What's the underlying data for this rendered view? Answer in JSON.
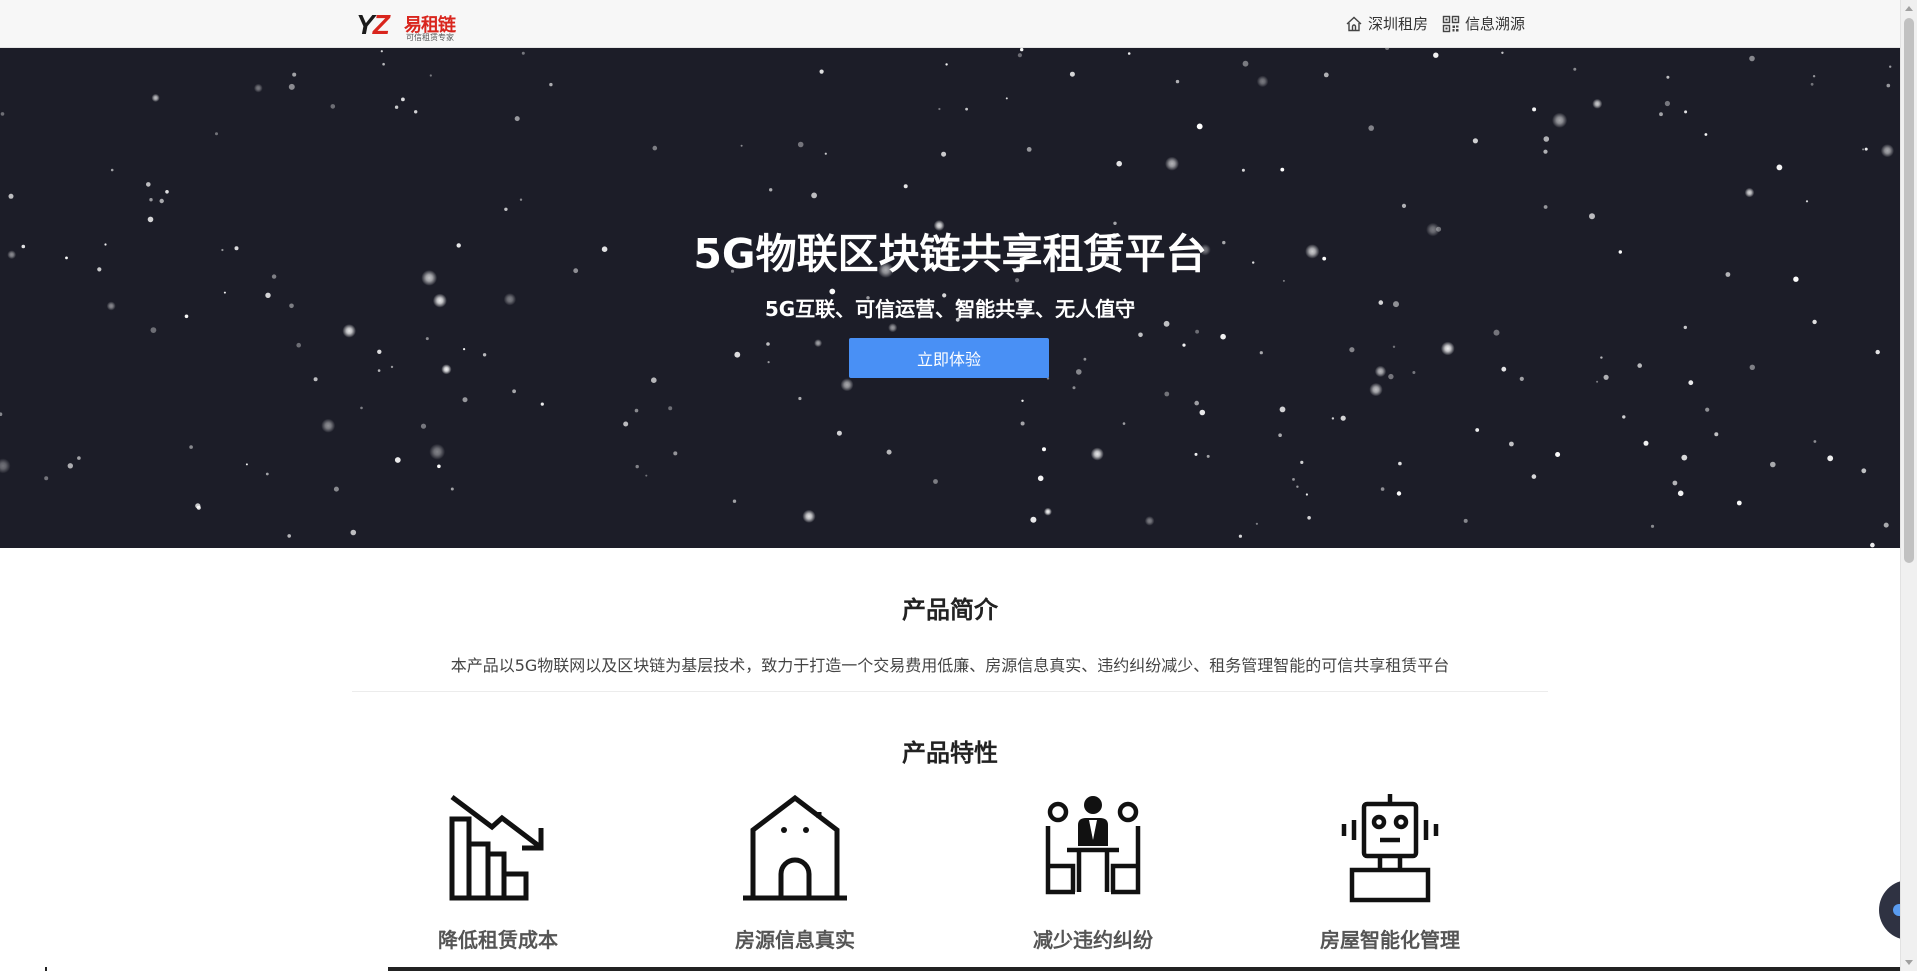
{
  "header": {
    "logo": {
      "letter_y": "Y",
      "letter_z": "Z",
      "brand": "易租链",
      "slogan": "可信租赁专家"
    },
    "nav": [
      {
        "label": "深圳租房",
        "icon": "home-icon"
      },
      {
        "label": "信息溯源",
        "icon": "qrcode-icon"
      }
    ]
  },
  "hero": {
    "title": "5G物联区块链共享租赁平台",
    "subtitle": "5G互联、可信运营、智能共享、无人值守",
    "cta_label": "立即体验"
  },
  "intro": {
    "title": "产品简介",
    "text": "本产品以5G物联网以及区块链为基层技术，致力于打造一个交易费用低廉、房源信息真实、违约纠纷减少、租务管理智能的可信共享租赁平台"
  },
  "features": {
    "title": "产品特性",
    "items": [
      {
        "label": "降低租赁成本",
        "icon": "declining-chart-icon"
      },
      {
        "label": "房源信息真实",
        "icon": "house-icon"
      },
      {
        "label": "减少违约纠纷",
        "icon": "meeting-icon"
      },
      {
        "label": "房屋智能化管理",
        "icon": "robot-icon"
      }
    ]
  },
  "colors": {
    "hero_bg": "#1c1d28",
    "cta": "#4990f5",
    "brand_red": "#d9251d"
  }
}
